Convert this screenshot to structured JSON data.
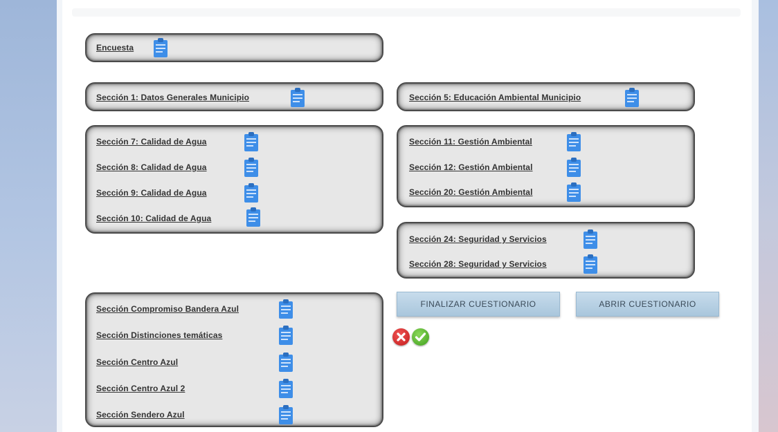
{
  "colors": {
    "panel_bg": "#e7e7e7",
    "panel_border": "#4a4a4a",
    "link": "#333333",
    "icon": "#3e8ee8",
    "button_bg": "#b4d0e4",
    "button_text": "#3a4a58",
    "cancel": "#d62a2a",
    "confirm": "#5ab82b"
  },
  "encuesta": {
    "label": "Encuesta",
    "icon": "clipboard-icon"
  },
  "sec1": {
    "label": "Sección 1: Datos Generales Municipio",
    "icon": "clipboard-icon"
  },
  "sec5": {
    "label": "Sección 5: Educación Ambiental Municipio",
    "icon": "clipboard-icon"
  },
  "agua": [
    {
      "label": "Sección 7: Calidad de Agua"
    },
    {
      "label": "Sección 8: Calidad de Agua"
    },
    {
      "label": "Sección 9: Calidad de Agua"
    },
    {
      "label": "Sección 10: Calidad de Agua"
    }
  ],
  "gestion": [
    {
      "label": "Sección 11: Gestión Ambiental"
    },
    {
      "label": "Sección 12: Gestión Ambiental"
    },
    {
      "label": "Sección 20: Gestión Ambiental"
    }
  ],
  "seguridad": [
    {
      "label": "Sección 24: Seguridad y Servicios"
    },
    {
      "label": "Sección 28: Seguridad y Servicios"
    }
  ],
  "bandera": [
    {
      "label": "Sección Compromiso Bandera Azul"
    },
    {
      "label": "Sección Distinciones temáticas"
    },
    {
      "label": "Sección Centro Azul"
    },
    {
      "label": "Sección Centro Azul 2"
    },
    {
      "label": "Sección Sendero Azul"
    }
  ],
  "buttons": {
    "finalizar": "FINALIZAR CUESTIONARIO",
    "abrir": "ABRIR CUESTIONARIO"
  },
  "status_icons": {
    "cancel": "close-icon",
    "confirm": "check-icon"
  }
}
